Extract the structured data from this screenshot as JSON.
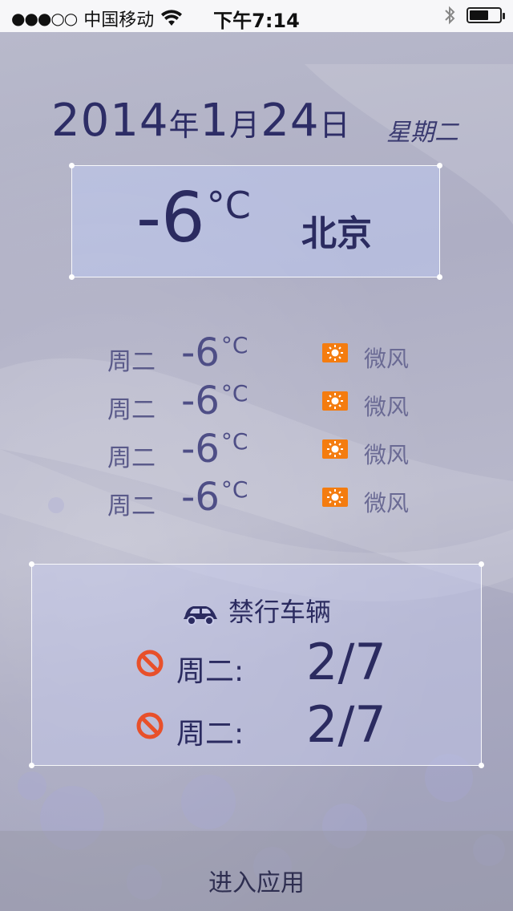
{
  "status_bar": {
    "signal": "●●●○○",
    "carrier": "中国移动",
    "time": "下午7:14",
    "battery_level": 0.65
  },
  "date": {
    "year": "2014",
    "year_unit": "年",
    "month": "1",
    "month_unit": "月",
    "day": "24",
    "day_unit": "日",
    "weekday": "星期二"
  },
  "current": {
    "temp": "-6",
    "temp_unit": "°C",
    "city": "北京"
  },
  "forecast": [
    {
      "day": "周二",
      "temp": "-6",
      "unit": "°C",
      "icon": "sun-icon",
      "wind": "微风"
    },
    {
      "day": "周二",
      "temp": "-6",
      "unit": "°C",
      "icon": "sun-icon",
      "wind": "微风"
    },
    {
      "day": "周二",
      "temp": "-6",
      "unit": "°C",
      "icon": "sun-icon",
      "wind": "微风"
    },
    {
      "day": "周二",
      "temp": "-6",
      "unit": "°C",
      "icon": "sun-icon",
      "wind": "微风"
    }
  ],
  "restriction": {
    "title": "禁行车辆",
    "rows": [
      {
        "day": "周二:",
        "numbers": "2/7"
      },
      {
        "day": "周二:",
        "numbers": "2/7"
      }
    ]
  },
  "bottom": {
    "enter_label": "进入应用"
  },
  "colors": {
    "text_primary": "#2b2b60",
    "accent_orange": "#f47c0f",
    "ban_red": "#e8502a"
  }
}
